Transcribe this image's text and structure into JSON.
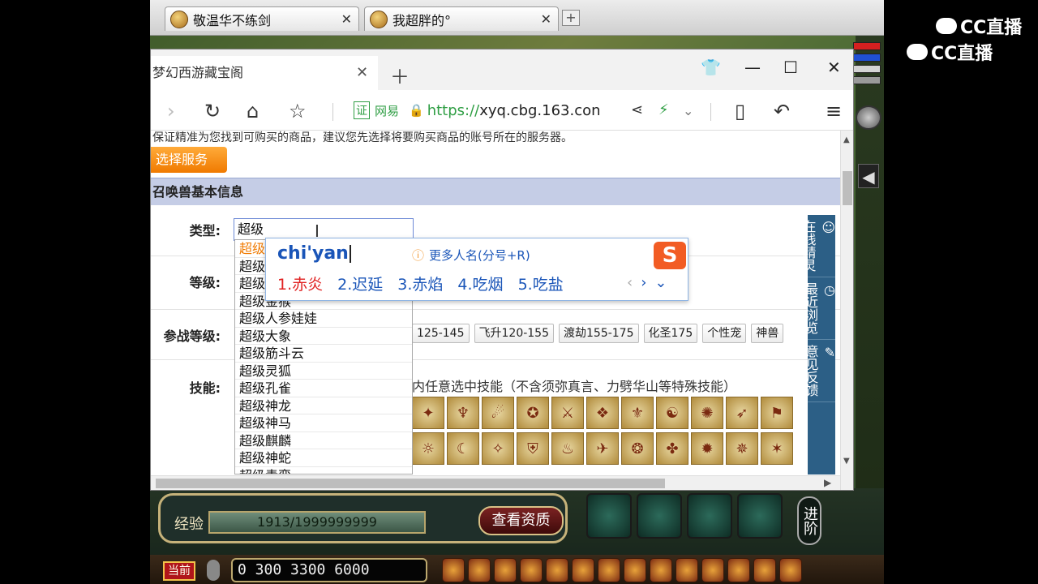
{
  "game": {
    "tabs": [
      {
        "title": "敬温华不练剑"
      },
      {
        "title": "我超胖的°"
      }
    ],
    "exp_label": "经验",
    "exp_value": "1913/1999999999",
    "view_aptitude": "查看资质",
    "advance": "进阶",
    "current_channel": "当前",
    "chat_input": "0 300 3300 6000"
  },
  "watermark": {
    "text": "CC直播"
  },
  "browser": {
    "tab_title": "梦幻西游藏宝阁",
    "address": {
      "cert": "证",
      "provider": "网易",
      "https": "https://",
      "domain": "xyq.cbg.163.con"
    }
  },
  "page": {
    "notice": "保证精准为您找到可购买的商品，建议您先选择将要购买商品的账号所在的服务器。",
    "select_server": "选择服务",
    "section_title": "召唤兽基本信息",
    "labels": {
      "type": "类型:",
      "level": "等级:",
      "battle_level": "参战等级:",
      "skills": "技能:"
    },
    "type_input": "超级",
    "dropdown": [
      "超级",
      "超级",
      "超级",
      "超级金猴",
      "超级人参娃娃",
      "超级大象",
      "超级筋斗云",
      "超级灵狐",
      "超级孔雀",
      "超级神龙",
      "超级神马",
      "超级麒麟",
      "超级神蛇",
      "超级青鸾"
    ],
    "battle_buttons": [
      "125-145",
      "飞升120-155",
      "渡劫155-175",
      "化圣175",
      "个性宠",
      "神兽"
    ],
    "skill_hint": "内任意选中技能（不含须弥真言、力劈华山等特殊技能）",
    "side_panel": [
      {
        "label": "在线精灵",
        "icon": "☺"
      },
      {
        "label": "最近浏览",
        "icon": "◷"
      },
      {
        "label": "意见反馈",
        "icon": "✎"
      }
    ]
  },
  "ime": {
    "pinyin": "chi'yan",
    "tip": "更多人名(分号+R)",
    "candidates": [
      "1.赤炎",
      "2.迟延",
      "3.赤焰",
      "4.吃烟",
      "5.吃盐"
    ],
    "logo": "S"
  }
}
